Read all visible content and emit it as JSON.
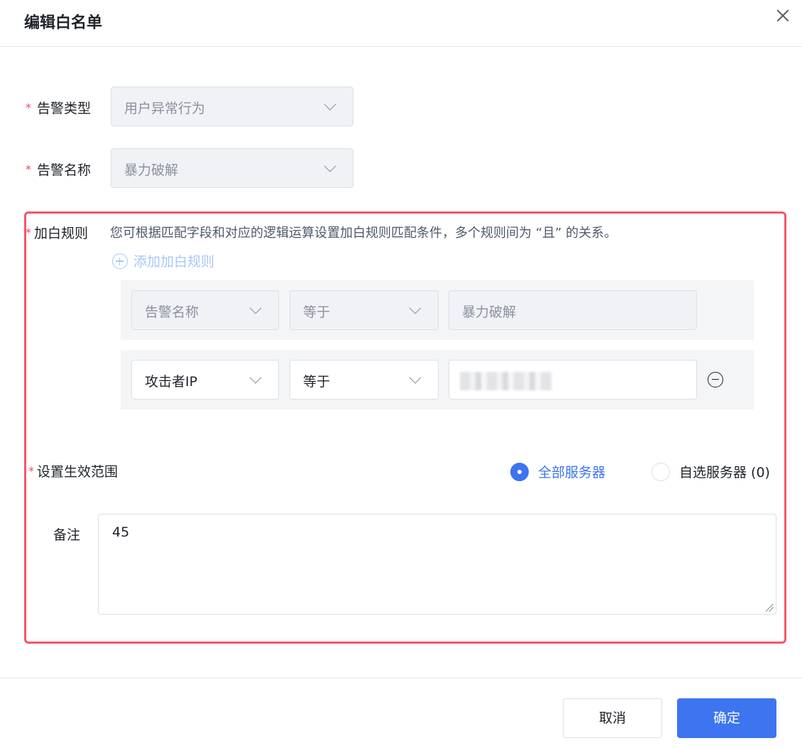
{
  "dialog": {
    "title": "编辑白名单"
  },
  "form": {
    "alert_type": {
      "label": "告警类型",
      "value": "用户异常行为"
    },
    "alert_name": {
      "label": "告警名称",
      "value": "暴力破解"
    },
    "whitelist_rules": {
      "label": "加白规则",
      "description": "您可根据匹配字段和对应的逻辑运算设置加白规则匹配条件，多个规则间为 “且” 的关系。",
      "add_label": "添加加白规则",
      "rows": [
        {
          "field": "告警名称",
          "operator": "等于",
          "value": "暴力破解"
        },
        {
          "field": "攻击者IP",
          "operator": "等于",
          "value": ""
        }
      ]
    },
    "scope": {
      "label": "设置生效范围",
      "options": [
        {
          "label": "全部服务器",
          "checked": true
        },
        {
          "label": "自选服务器 (0)",
          "checked": false
        }
      ]
    },
    "remark": {
      "label": "备注",
      "value": "45"
    }
  },
  "footer": {
    "cancel_label": "取消",
    "confirm_label": "确定"
  },
  "colors": {
    "primary": "#3d74f0",
    "required": "#f5455c",
    "highlight_border": "#f5566a"
  }
}
